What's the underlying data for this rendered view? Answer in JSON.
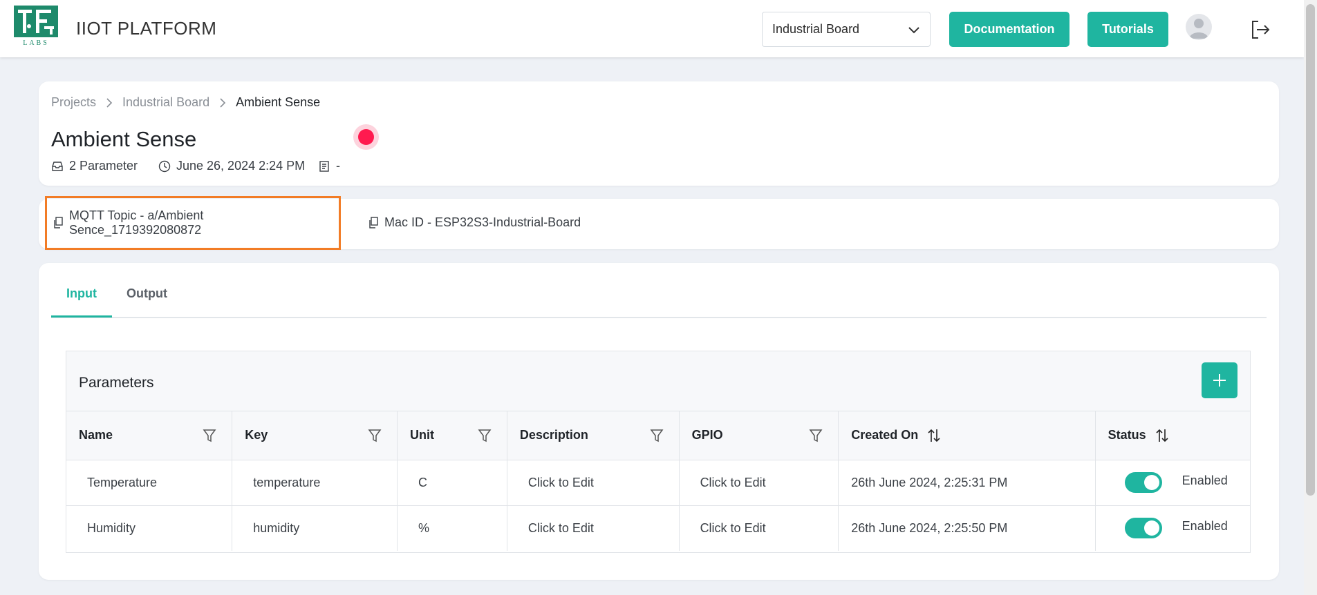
{
  "header": {
    "logo_text": "LABS",
    "brand": "IIOT PLATFORM",
    "project_select": {
      "value": "Industrial Board"
    },
    "documentation_label": "Documentation",
    "tutorials_label": "Tutorials"
  },
  "breadcrumb": [
    "Projects",
    "Industrial Board",
    "Ambient Sense"
  ],
  "project": {
    "title": "Ambient Sense",
    "parameter_count": "2 Parameter",
    "created": "June 26, 2024 2:24 PM",
    "description": "-"
  },
  "topic": {
    "mqtt": "MQTT Topic - a/Ambient Sence_1719392080872",
    "mac": "Mac ID - ESP32S3-Industrial-Board"
  },
  "tabs": [
    {
      "label": "Input",
      "active": true
    },
    {
      "label": "Output",
      "active": false
    }
  ],
  "parameters": {
    "title": "Parameters",
    "columns": [
      "Name",
      "Key",
      "Unit",
      "Description",
      "GPIO",
      "Created On",
      "Status"
    ],
    "rows": [
      {
        "name": "Temperature",
        "key": "temperature",
        "unit": "C",
        "description": "Click to Edit",
        "gpio": "Click to Edit",
        "created_on": "26th June 2024, 2:25:31 PM",
        "status": "Enabled"
      },
      {
        "name": "Humidity",
        "key": "humidity",
        "unit": "%",
        "description": "Click to Edit",
        "gpio": "Click to Edit",
        "created_on": "26th June 2024, 2:25:50 PM",
        "status": "Enabled"
      }
    ]
  },
  "colors": {
    "accent": "#1fb5a0",
    "status_dot": "#ff1a4f",
    "highlight_border": "#f27c26"
  },
  "icons": [
    "logo-icon",
    "chevron-down-icon",
    "avatar-icon",
    "logout-icon",
    "chevron-right-icon",
    "inbox-icon",
    "clock-icon",
    "document-icon",
    "copy-icon",
    "plus-icon",
    "filter-icon",
    "sort-icon"
  ]
}
